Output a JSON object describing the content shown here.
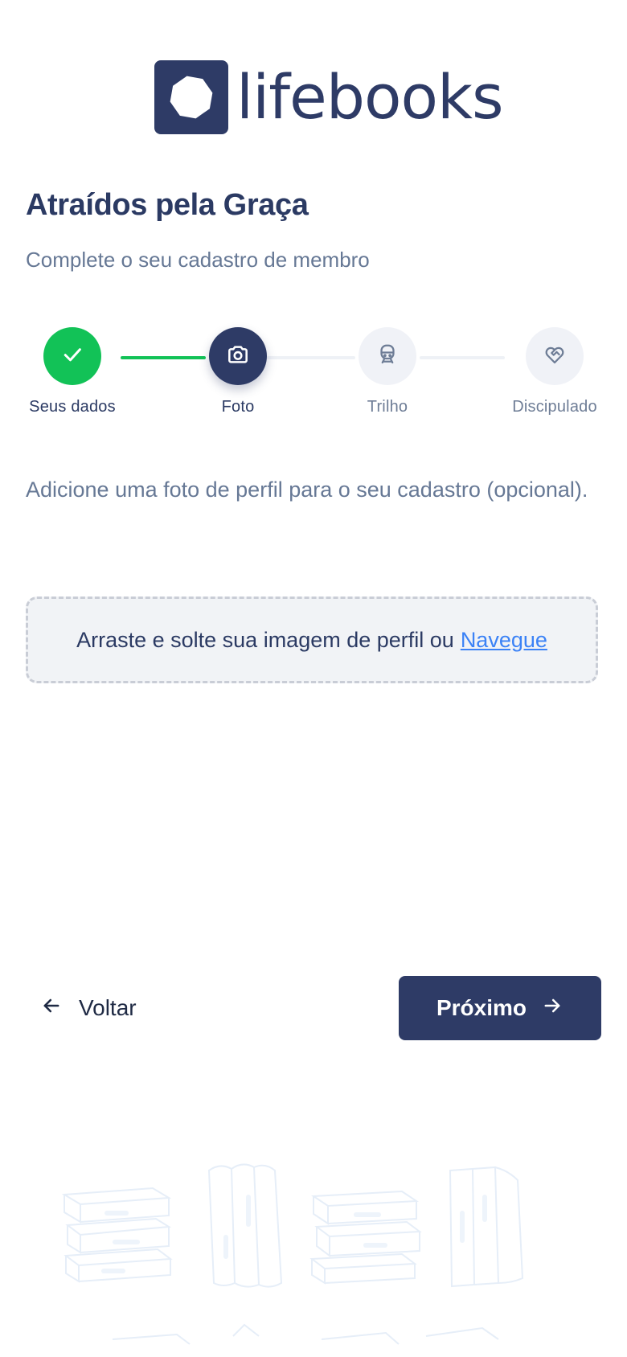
{
  "brand": {
    "name": "lifebooks",
    "color": "#2e3b66"
  },
  "header": {
    "title": "Atraídos pela Graça",
    "subtitle": "Complete o seu cadastro de membro"
  },
  "stepper": {
    "steps": [
      {
        "label": "Seus dados",
        "status": "done",
        "icon": "check-icon"
      },
      {
        "label": "Foto",
        "status": "active",
        "icon": "camera-icon"
      },
      {
        "label": "Trilho",
        "status": "pending",
        "icon": "train-icon"
      },
      {
        "label": "Discipulado",
        "status": "pending",
        "icon": "heart-handshake-icon"
      }
    ],
    "colors": {
      "done": "#12c257",
      "active": "#2e3b66",
      "pending": "#f0f2f7"
    }
  },
  "main": {
    "description": "Adicione uma foto de perfil para o seu cadastro (opcional).",
    "dropzone": {
      "text": "Arraste e solte sua imagem de perfil ou",
      "link": "Navegue"
    }
  },
  "footer": {
    "back_label": "Voltar",
    "next_label": "Próximo"
  }
}
